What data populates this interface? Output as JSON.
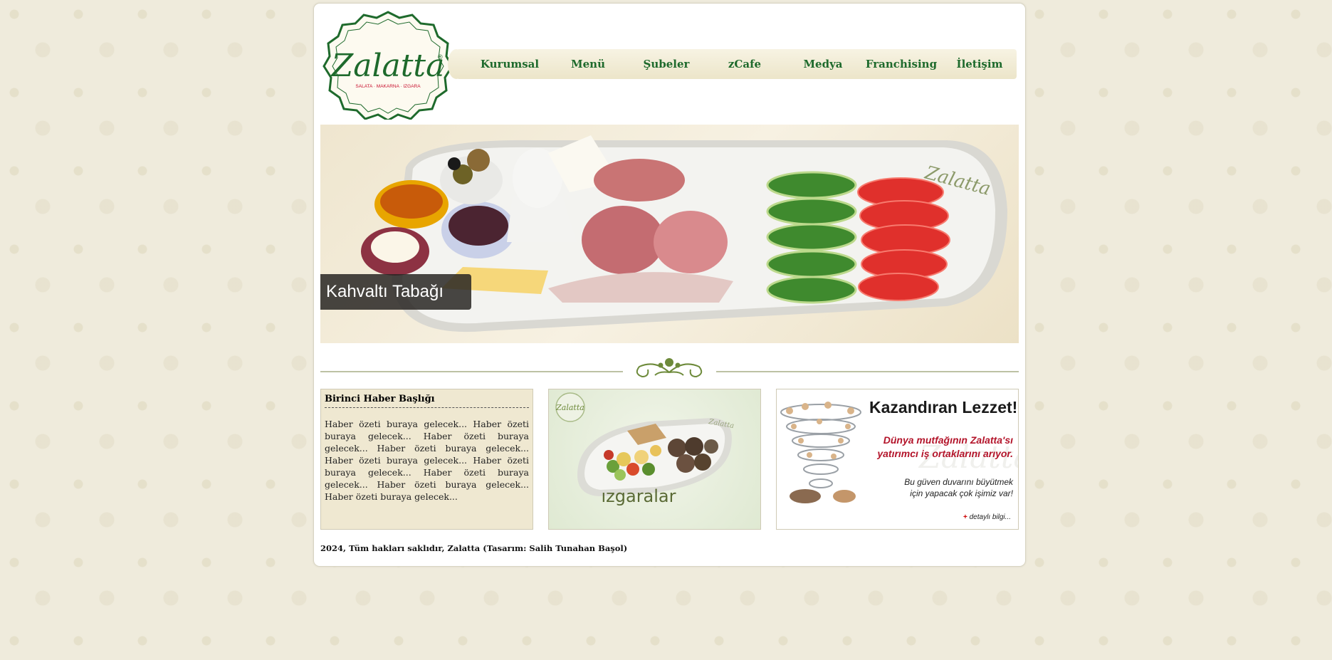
{
  "brand": {
    "name": "Zalatta",
    "tagline": "SALATA · MAKARNA · IZGARA",
    "registered_mark": "®",
    "green": "#1e6a2c",
    "red": "#c8102e"
  },
  "nav": {
    "items": [
      "Kurumsal",
      "Menü",
      "Şubeler",
      "zCafe",
      "Medya",
      "Franchising",
      "İletişim"
    ]
  },
  "hero": {
    "caption": "Kahvaltı Tabağı",
    "plate_logo": "Zalatta"
  },
  "news": {
    "title": "Birinci Haber Başlığı",
    "body": "Haber özeti buraya gelecek... Haber özeti buraya gelecek... Haber özeti buraya gelecek... Haber özeti buraya gelecek... Haber özeti buraya gelecek... Haber özeti buraya gelecek... Haber özeti buraya gelecek... Haber özeti buraya gelecek... Haber özeti buraya gelecek..."
  },
  "grill_banner": {
    "label": "ızgaralar",
    "badge": "Zalatta",
    "plate_logo": "Zalatta"
  },
  "promo_banner": {
    "title": "Kazandıran Lezzet!",
    "headline_line1": "Dünya mutfağının Zalatta'sı",
    "headline_line2": "yatırımcı iş ortaklarını arıyor.",
    "text_line1": "Bu güven duvarını büyütmek",
    "text_line2": "için yapacak çok işimiz var!",
    "link_plus": "+",
    "link_text": "detaylı bilgi...",
    "watermark": "Zalatta"
  },
  "footer": {
    "text": "2024, Tüm hakları saklıdır, Zalatta (Tasarım: Salih Tunahan Başol)"
  }
}
